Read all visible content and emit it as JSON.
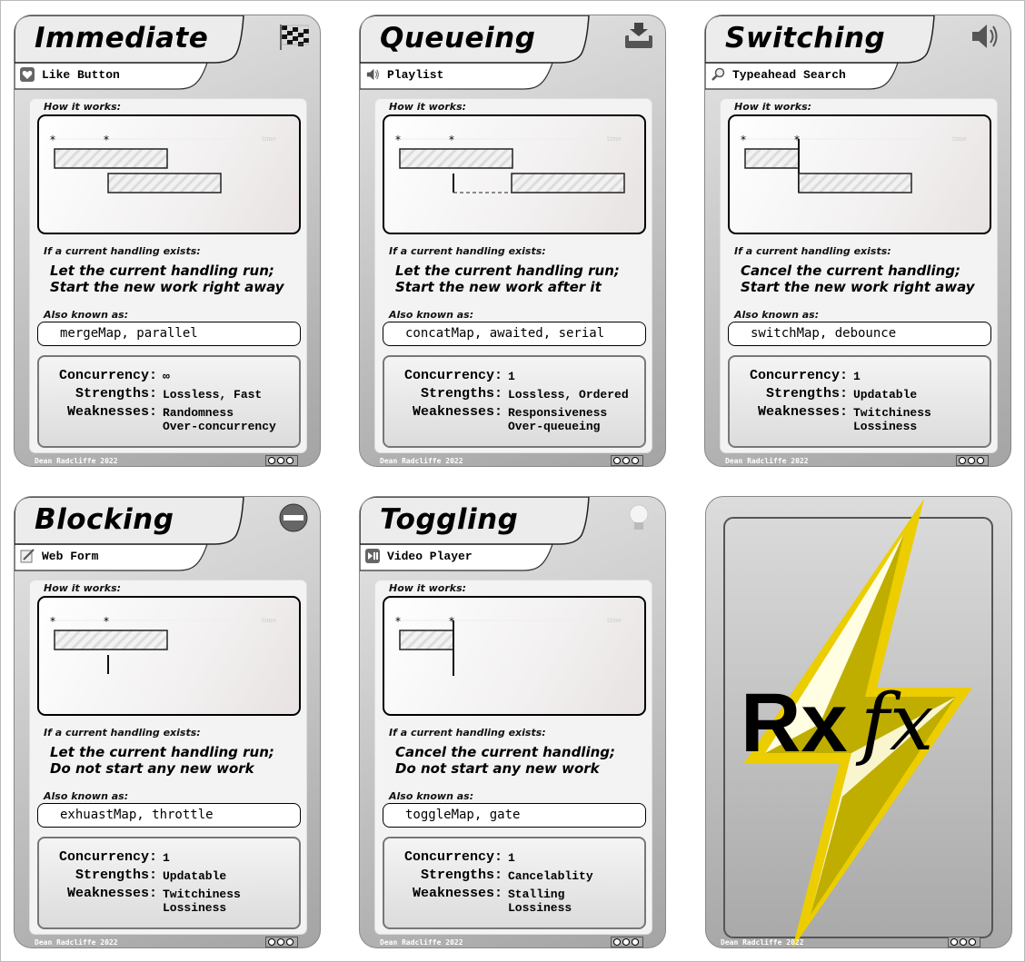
{
  "author": "Dean Radcliffe 2022",
  "labels": {
    "how": "How it works:",
    "if": "If a current handling exists:",
    "aka": "Also known as:",
    "concurrency": "Concurrency:",
    "strengths": "Strengths:",
    "weaknesses": "Weaknesses:",
    "time": "time"
  },
  "cards": [
    {
      "title": "Immediate",
      "icon": "checkered-flag-icon",
      "subtitle": "Like Button",
      "subtitle_icon": "heart-icon",
      "diagram": "immediate",
      "rule": [
        "Let the current handling run;",
        "Start the new work right away"
      ],
      "aka": "mergeMap, parallel",
      "concurrency": "∞",
      "strengths": "Lossless, Fast",
      "weaknesses": [
        "Randomness",
        "Over-concurrency"
      ]
    },
    {
      "title": "Queueing",
      "icon": "inbox-download-icon",
      "subtitle": "Playlist",
      "subtitle_icon": "speaker-icon",
      "diagram": "queueing",
      "rule": [
        "Let the current handling run;",
        "Start the new work after it"
      ],
      "aka": "concatMap, awaited, serial",
      "concurrency": "1",
      "strengths": "Lossless, Ordered",
      "weaknesses": [
        "Responsiveness",
        "Over-queueing"
      ]
    },
    {
      "title": "Switching",
      "icon": "speaker-icon",
      "subtitle": "Typeahead Search",
      "subtitle_icon": "magnifier-icon",
      "diagram": "switching",
      "rule": [
        "Cancel the current handling;",
        "Start the new work right away"
      ],
      "aka": "switchMap, debounce",
      "concurrency": "1",
      "strengths": "Updatable",
      "weaknesses": [
        "Twitchiness",
        "Lossiness"
      ]
    },
    {
      "title": "Blocking",
      "icon": "no-entry-icon",
      "subtitle": "Web Form",
      "subtitle_icon": "memo-icon",
      "diagram": "blocking",
      "rule": [
        "Let the current handling run;",
        "Do not start any new work"
      ],
      "aka": "exhuastMap, throttle",
      "concurrency": "1",
      "strengths": "Updatable",
      "weaknesses": [
        "Twitchiness",
        "Lossiness"
      ]
    },
    {
      "title": "Toggling",
      "icon": "lightbulb-icon",
      "subtitle": "Video Player",
      "subtitle_icon": "play-pause-icon",
      "diagram": "toggling",
      "rule": [
        "Cancel the current handling;",
        "Do not start any new work"
      ],
      "aka": "toggleMap, gate",
      "concurrency": "1",
      "strengths": "Cancelablity",
      "weaknesses": [
        "Stalling",
        "Lossiness"
      ]
    }
  ],
  "logo_card": {
    "logo_text": "Rxfx",
    "author": "Dean Radcliffe 2022"
  },
  "colors": {
    "bolt_outer": "#eccd00",
    "bolt_inner": "#bfae00",
    "bolt_light": "#fffde2"
  }
}
